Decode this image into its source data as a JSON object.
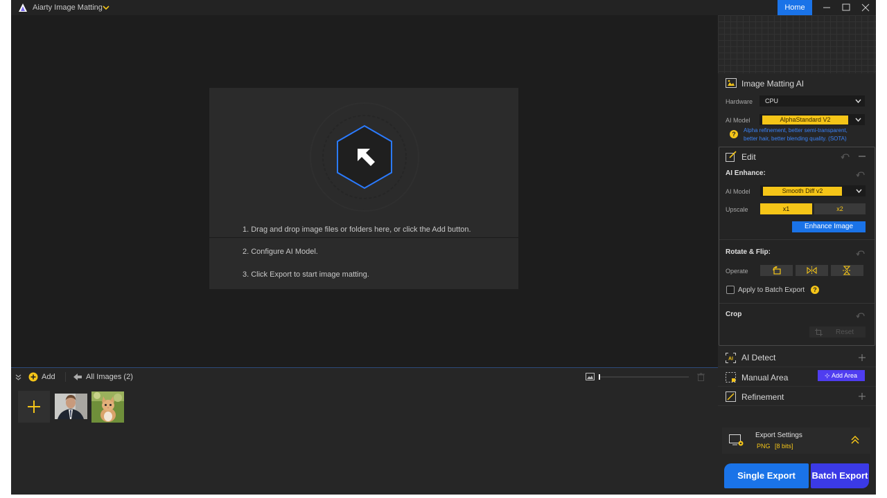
{
  "app": {
    "title": "Aiarty Image Matting",
    "home_label": "Home"
  },
  "steps": [
    "1. Drag and drop image files or folders here, or click the Add button.",
    "2. Configure AI Model.",
    "3. Click Export to start image matting."
  ],
  "bottom": {
    "add_label": "Add",
    "all_images_label": "All Images (2)"
  },
  "matting": {
    "title": "Image Matting AI",
    "hardware_label": "Hardware",
    "hardware_value": "CPU",
    "model_label": "AI Model",
    "model_value": "AlphaStandard  V2",
    "model_hint_line1": "Alpha refinement, better semi-transparent,",
    "model_hint_line2": "better hair, better blending quality. (SOTA)"
  },
  "edit": {
    "title": "Edit",
    "enhance_title": "AI Enhance:",
    "model_label": "AI Model",
    "model_value": "Smooth Diff v2",
    "upscale_label": "Upscale",
    "upscale_options": [
      "x1",
      "x2"
    ],
    "enhance_button": "Enhance Image",
    "rotate_title": "Rotate & Flip:",
    "operate_label": "Operate",
    "batch_label": "Apply to Batch Export",
    "crop_title": "Crop",
    "reset_label": "Reset"
  },
  "sections": {
    "ai_detect": "AI Detect",
    "manual_area": "Manual Area",
    "add_area": "Add Area",
    "refinement": "Refinement"
  },
  "export": {
    "title": "Export Settings",
    "format": "PNG",
    "bits": "[8 bits]",
    "single_label": "Single Export",
    "batch_label": "Batch Export"
  },
  "colors": {
    "accent_blue": "#1a73e8",
    "accent_yellow": "#f5c518",
    "purple": "#4f3df0"
  }
}
